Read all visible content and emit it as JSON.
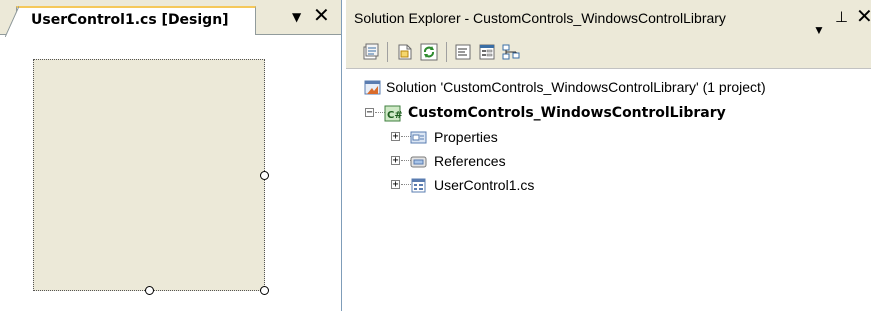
{
  "designer": {
    "tab_title": "UserControl1.cs [Design]",
    "dropdown_glyph": "▼",
    "close_glyph": "✕"
  },
  "solution_explorer": {
    "title": "Solution Explorer - CustomControls_WindowsControlLibrary",
    "dropdown_glyph": "▼",
    "pin_glyph": "⊥",
    "close_glyph": "✕",
    "toolbar": [
      {
        "name": "properties-icon"
      },
      {
        "name": "show-all-files-icon"
      },
      {
        "name": "refresh-icon"
      },
      {
        "name": "view-code-icon"
      },
      {
        "name": "view-designer-icon"
      },
      {
        "name": "class-diagram-icon"
      }
    ],
    "tree": {
      "solution_label": "Solution 'CustomControls_WindowsControlLibrary' (1 project)",
      "project_label": "CustomControls_WindowsControlLibrary",
      "items": [
        {
          "label": "Properties",
          "icon": "properties-folder-icon"
        },
        {
          "label": "References",
          "icon": "references-icon"
        },
        {
          "label": "UserControl1.cs",
          "icon": "form-file-icon"
        }
      ],
      "expander_collapsed": "+",
      "expander_expanded": "−"
    }
  },
  "colors": {
    "chrome": "#ece9d8",
    "tab_highlight": "#f5c85a",
    "border": "#919b9c"
  }
}
